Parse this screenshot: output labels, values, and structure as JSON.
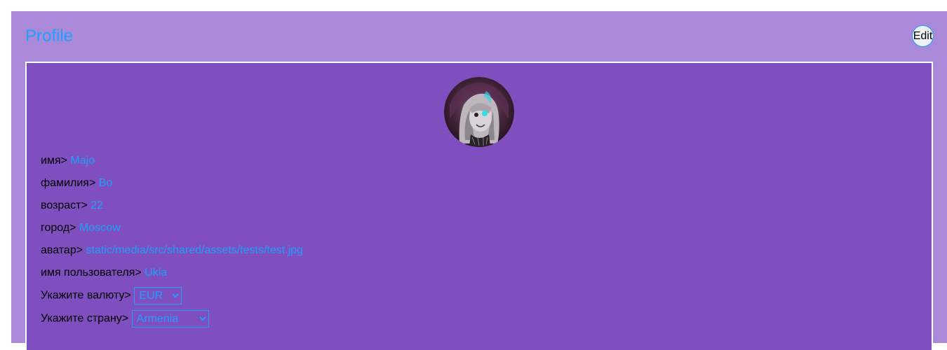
{
  "header": {
    "title": "Profile",
    "edit_label": "Edit"
  },
  "profile": {
    "fields": [
      {
        "label": "имя>",
        "value": "Majo"
      },
      {
        "label": "фамилия>",
        "value": "Bo"
      },
      {
        "label": "возраст>",
        "value": "22"
      },
      {
        "label": "город>",
        "value": "Moscow"
      },
      {
        "label": "аватар>",
        "value": "static/media/src/shared/assets/tests/test.jpg"
      },
      {
        "label": "имя пользователя>",
        "value": "Ukla"
      }
    ],
    "currency": {
      "label": "Укажите валюту>",
      "selected": "EUR"
    },
    "country": {
      "label": "Укажите страну>",
      "selected": "Armenia"
    }
  },
  "colors": {
    "page_bg": "#aa8ad8",
    "card_bg": "#7f4fbf",
    "accent": "#1ea0ff"
  }
}
